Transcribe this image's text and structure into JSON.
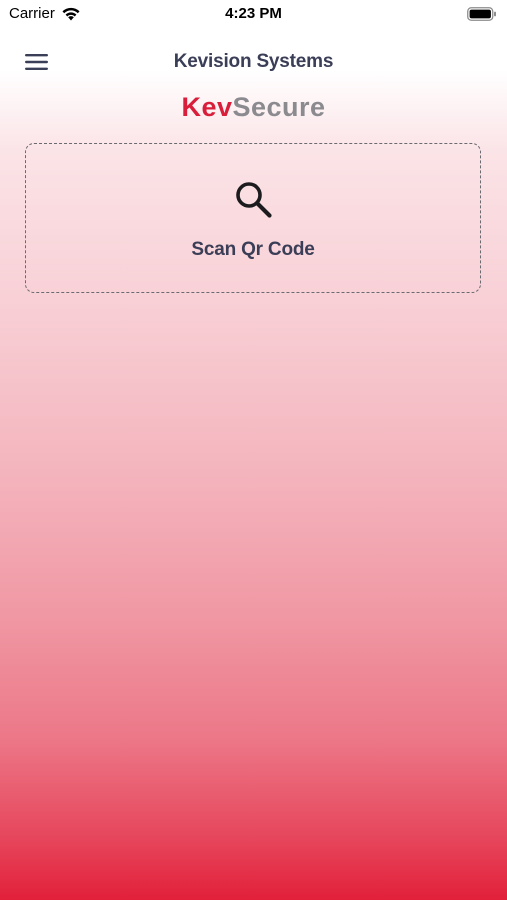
{
  "status_bar": {
    "carrier": "Carrier",
    "time": "4:23 PM",
    "wifi_icon": "wifi-icon",
    "battery_icon": "battery-icon"
  },
  "nav_bar": {
    "title": "Kevision Systems",
    "menu_icon": "hamburger-menu-icon"
  },
  "brand": {
    "part1": "Kev",
    "part2": "Secure",
    "part1_color": "#d81e3a",
    "part2_color": "#8a8a8f"
  },
  "scan_card": {
    "icon": "search-icon",
    "label": "Scan Qr Code"
  },
  "colors": {
    "title_text": "#3b3e57",
    "gradient_bottom": "#e2203a"
  }
}
